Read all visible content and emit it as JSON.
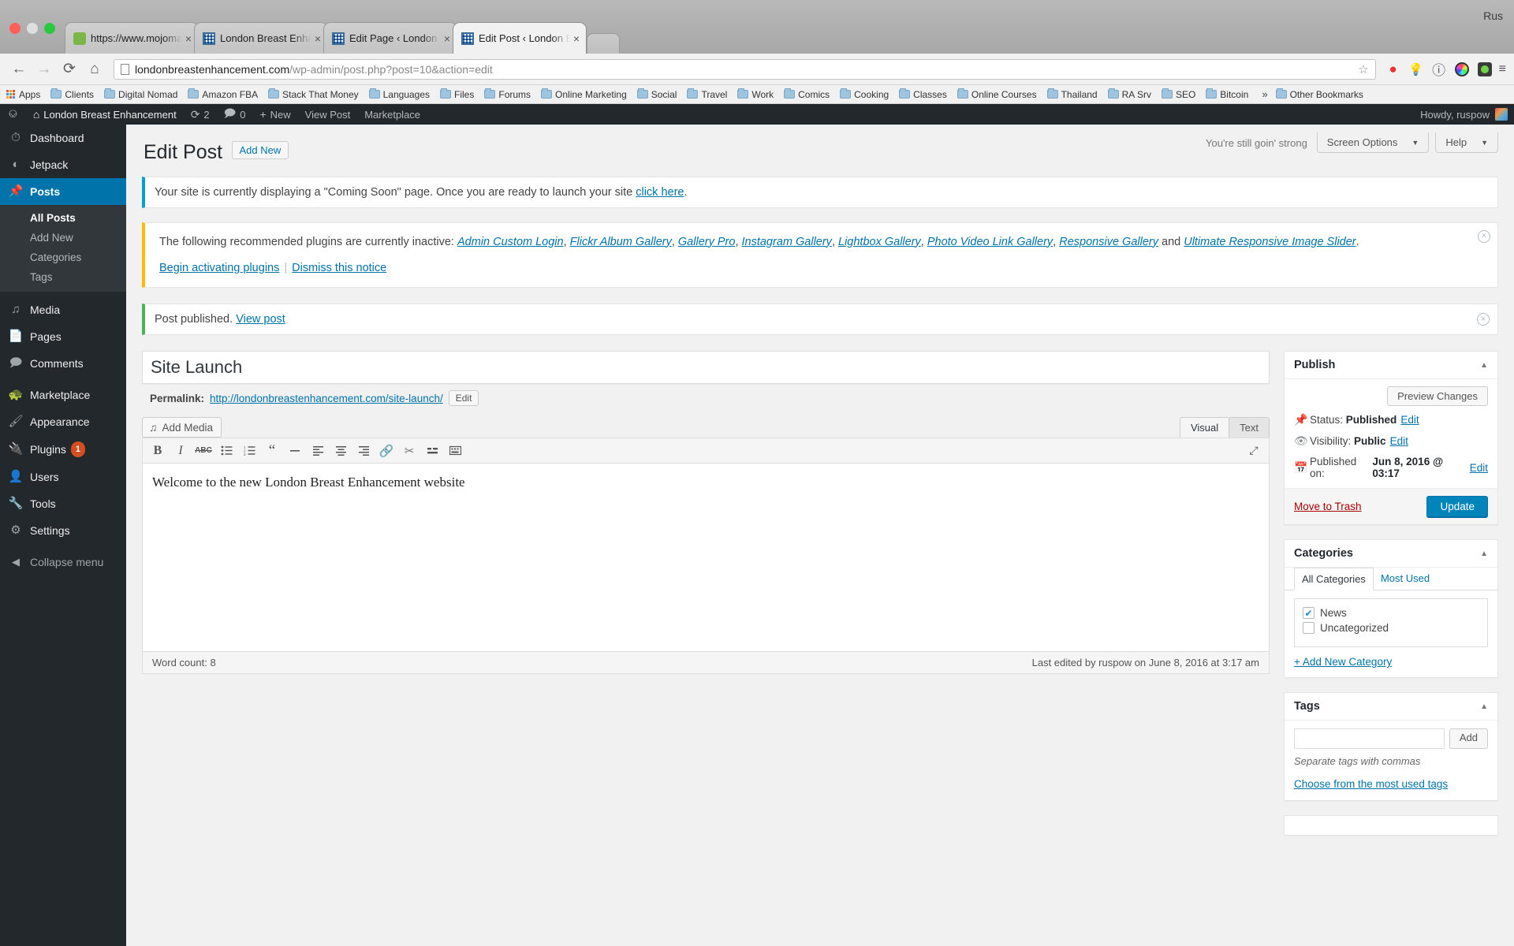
{
  "browser": {
    "tabs": [
      {
        "title": "https://www.mojomarketpla",
        "favicon": "mojo-icon",
        "active": false
      },
      {
        "title": "London Breast Enhanceme",
        "favicon": "wordpress-icon",
        "active": false
      },
      {
        "title": "Edit Page ‹ London Breast",
        "favicon": "wordpress-icon",
        "active": false
      },
      {
        "title": "Edit Post ‹ London Breast E",
        "favicon": "wordpress-icon",
        "active": true
      }
    ],
    "close_glyph": "×",
    "window_language": "Rus",
    "nav": {
      "back": "←",
      "forward": "→",
      "reload": "⟳",
      "home": "⌂"
    },
    "url_domain": "londonbreastenhancement.com",
    "url_path": "/wp-admin/post.php?post=10&action=edit",
    "star": "☆",
    "extensions": [
      "adblock-icon",
      "lamp-icon",
      "info-icon",
      "color-picker-icon",
      "green-dot-icon"
    ],
    "menu_glyph": "≡",
    "bookmarks": [
      "Apps",
      "Clients",
      "Digital Nomad",
      "Amazon FBA",
      "Stack That Money",
      "Languages",
      "Files",
      "Forums",
      "Online Marketing",
      "Social",
      "Travel",
      "Work",
      "Comics",
      "Cooking",
      "Classes",
      "Online Courses",
      "Thailand",
      "RA Srv",
      "SEO",
      "Bitcoin"
    ],
    "bookmarks_overflow": "»",
    "other_bookmarks": "Other Bookmarks"
  },
  "adminbar": {
    "logo": "wordpress-logo-icon",
    "home_icon": "home-icon",
    "site_name": "London Breast Enhancement",
    "updates_icon": "⟳",
    "updates_count": "2",
    "comments_icon": "💬",
    "comments_count": "0",
    "new_icon": "+",
    "new_label": "New",
    "view_post": "View Post",
    "marketplace": "Marketplace",
    "howdy": "Howdy, ruspow"
  },
  "sidebar": {
    "items": [
      {
        "label": "Dashboard",
        "icon": "dashboard-icon",
        "current": false
      },
      {
        "label": "Jetpack",
        "icon": "jetpack-icon",
        "current": false
      },
      {
        "label": "Posts",
        "icon": "pin-icon",
        "current": true
      },
      {
        "label": "Media",
        "icon": "media-icon",
        "current": false
      },
      {
        "label": "Pages",
        "icon": "pages-icon",
        "current": false
      },
      {
        "label": "Comments",
        "icon": "comments-icon",
        "current": false
      },
      {
        "label": "Marketplace",
        "icon": "marketplace-icon",
        "current": false
      },
      {
        "label": "Appearance",
        "icon": "brush-icon",
        "current": false
      },
      {
        "label": "Plugins",
        "icon": "plug-icon",
        "current": false,
        "badge": "1"
      },
      {
        "label": "Users",
        "icon": "users-icon",
        "current": false
      },
      {
        "label": "Tools",
        "icon": "tools-icon",
        "current": false
      },
      {
        "label": "Settings",
        "icon": "settings-icon",
        "current": false
      }
    ],
    "submenu": [
      {
        "label": "All Posts",
        "current": true
      },
      {
        "label": "Add New",
        "current": false
      },
      {
        "label": "Categories",
        "current": false
      },
      {
        "label": "Tags",
        "current": false
      }
    ],
    "collapse": "Collapse menu",
    "collapse_icon": "◀"
  },
  "screen_meta": {
    "motivation": "You're still goin' strong",
    "screen_options": "Screen Options",
    "help": "Help",
    "caret": "▲"
  },
  "page": {
    "title": "Edit Post",
    "add_new": "Add New"
  },
  "notices": {
    "coming_soon": {
      "text_before": "Your site is currently displaying a \"Coming Soon\" page. Once you are ready to launch your site ",
      "link": "click here",
      "text_after": "."
    },
    "plugins": {
      "intro": "The following recommended plugins are currently inactive: ",
      "links": [
        "Admin Custom Login",
        "Flickr Album Gallery",
        "Gallery Pro",
        "Instagram Gallery",
        "Lightbox Gallery",
        "Photo Video Link Gallery",
        "Responsive Gallery"
      ],
      "conjunction": " and ",
      "last_link": "Ultimate Responsive Image Slider",
      "tail": ".",
      "action_begin": "Begin activating plugins",
      "separator": "|",
      "action_dismiss": "Dismiss this notice",
      "close": "×"
    },
    "published": {
      "text": "Post published. ",
      "link": "View post",
      "close": "×"
    }
  },
  "editor": {
    "post_title": "Site Launch",
    "permalink_label": "Permalink:",
    "permalink_url": "http://londonbreastenhancement.com/site-launch/",
    "permalink_edit": "Edit",
    "add_media": "Add Media",
    "tab_visual": "Visual",
    "tab_text": "Text",
    "toolbar_icons": [
      "bold-icon",
      "italic-icon",
      "strikethrough-icon",
      "bullet-list-icon",
      "numbered-list-icon",
      "blockquote-icon",
      "horizontal-rule-icon",
      "align-left-icon",
      "align-center-icon",
      "align-right-icon",
      "insert-link-icon",
      "unlink-icon",
      "read-more-icon",
      "toolbar-toggle-icon"
    ],
    "fullscreen_icon": "fullscreen-icon",
    "content": "Welcome to the new London Breast Enhancement website",
    "word_count_label": "Word count:",
    "word_count": "8",
    "last_edited": "Last edited by ruspow on June 8, 2016 at 3:17 am"
  },
  "publish_box": {
    "title": "Publish",
    "toggle": "▲",
    "preview": "Preview Changes",
    "status_icon": "pin-status-icon",
    "status_label": "Status:",
    "status_value": "Published",
    "status_edit": "Edit",
    "visibility_icon": "eye-icon",
    "visibility_label": "Visibility:",
    "visibility_value": "Public",
    "visibility_edit": "Edit",
    "published_icon": "calendar-icon",
    "published_label": "Published on:",
    "published_value": "Jun 8, 2016 @ 03:17",
    "published_edit": "Edit",
    "trash": "Move to Trash",
    "update": "Update"
  },
  "categories_box": {
    "title": "Categories",
    "toggle": "▲",
    "tab_all": "All Categories",
    "tab_most_used": "Most Used",
    "items": [
      {
        "label": "News",
        "checked": true
      },
      {
        "label": "Uncategorized",
        "checked": false
      }
    ],
    "check_glyph": "✔",
    "add_new": "+ Add New Category"
  },
  "tags_box": {
    "title": "Tags",
    "toggle": "▲",
    "input_value": "",
    "input_placeholder": "",
    "add": "Add",
    "hint": "Separate tags with commas",
    "choose": "Choose from the most used tags"
  }
}
